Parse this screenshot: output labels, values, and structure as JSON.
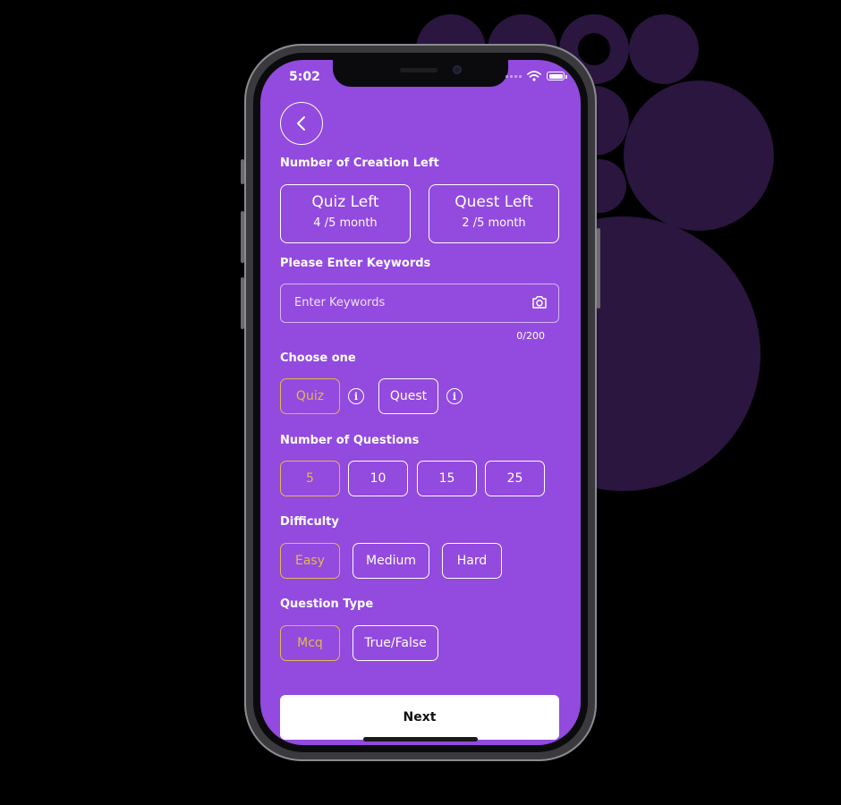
{
  "colors": {
    "screen_bg": "#924ADF",
    "selected": "#E5B94E",
    "deco": "#2A163F"
  },
  "status_bar": {
    "time": "5:02",
    "wifi_icon": "wifi-icon",
    "battery_icon": "battery-icon"
  },
  "header": {
    "back_icon": "chevron-left-icon"
  },
  "creation": {
    "label": "Number of Creation Left",
    "quiz": {
      "title": "Quiz Left",
      "sub": "4 /5 month"
    },
    "quest": {
      "title": "Quest Left",
      "sub": "2 /5 month"
    }
  },
  "keywords": {
    "label": "Please Enter Keywords",
    "placeholder": "Enter Keywords",
    "counter": "0/200",
    "camera_icon": "camera-icon"
  },
  "choose": {
    "label": "Choose one",
    "options": [
      "Quiz",
      "Quest"
    ],
    "selected": "Quiz"
  },
  "questions": {
    "label": "Number of Questions",
    "options": [
      "5",
      "10",
      "15",
      "25"
    ],
    "selected": "5"
  },
  "difficulty": {
    "label": "Difficulty",
    "options": [
      "Easy",
      "Medium",
      "Hard"
    ],
    "selected": "Easy"
  },
  "question_type": {
    "label": "Question Type",
    "options": [
      "Mcq",
      "True/False"
    ],
    "selected": "Mcq"
  },
  "footer": {
    "next_label": "Next"
  }
}
